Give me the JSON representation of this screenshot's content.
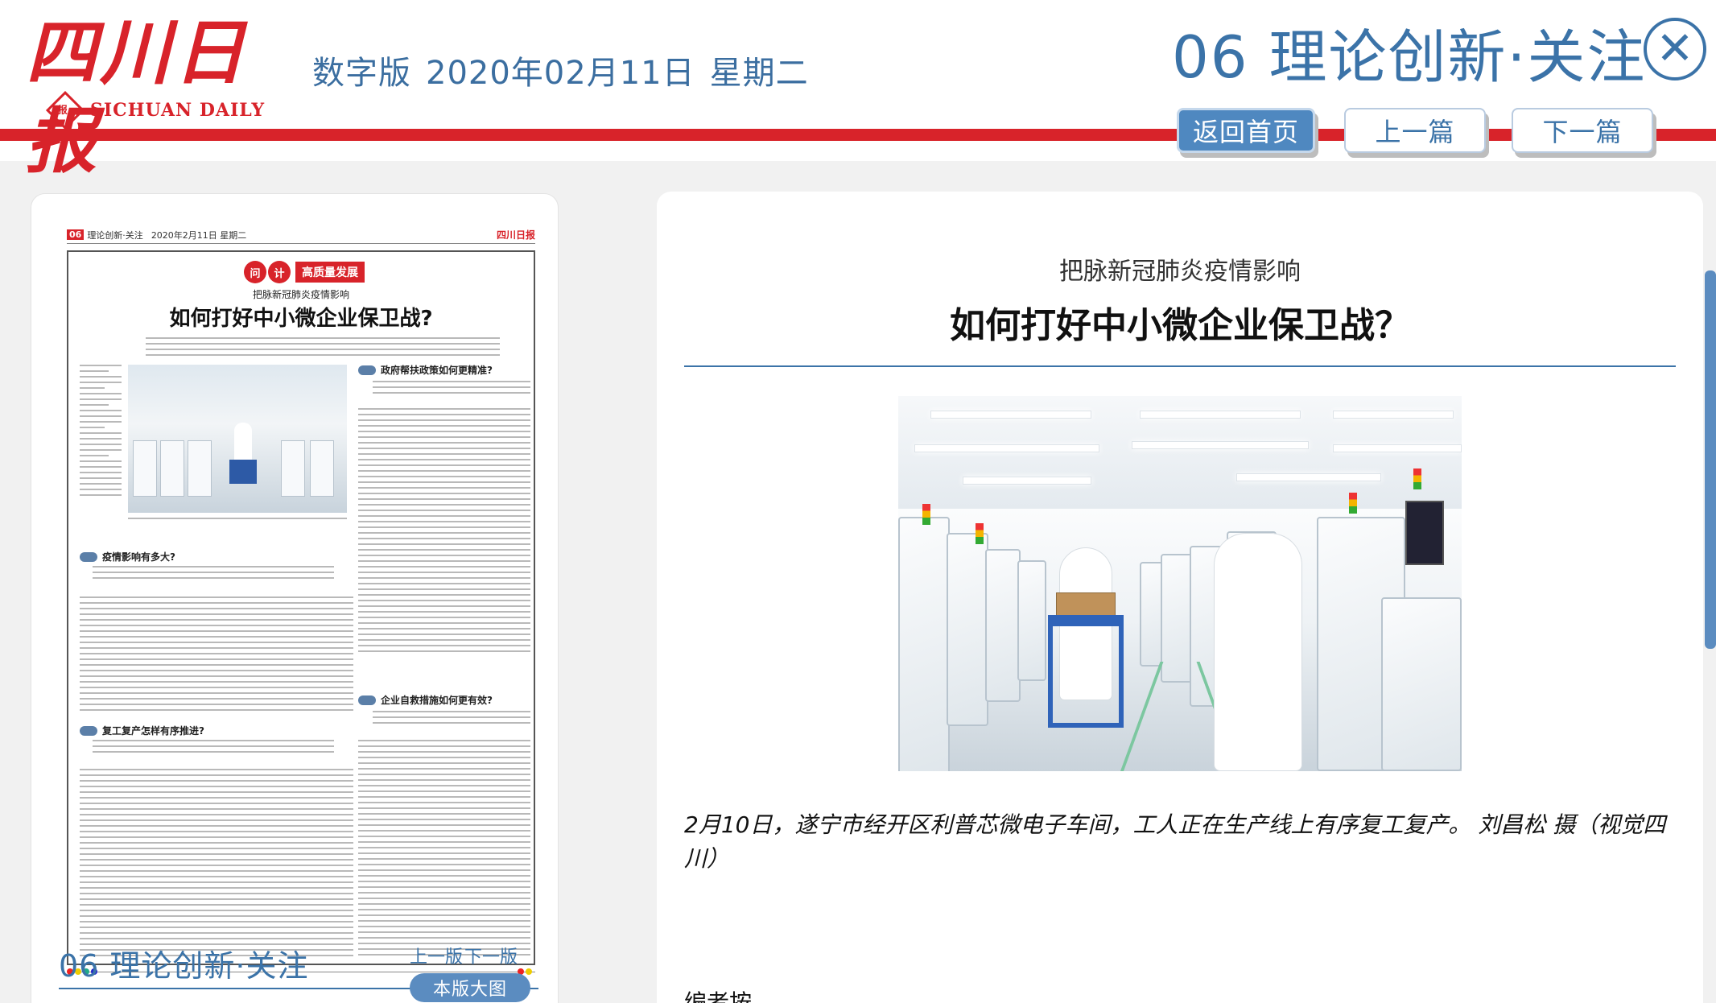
{
  "header": {
    "logo_cn": "四川日报",
    "logo_en": "SICHUAN DAILY",
    "logo_mark": "报",
    "edition_label": "数字版",
    "date": "2020年02月11日",
    "weekday": "星期二",
    "page_heading": "06 理论创新·关注",
    "close_glyph": "✕",
    "nav": {
      "home": "返回首页",
      "prev_article": "上一篇",
      "next_article": "下一篇"
    },
    "accent_red": "#d8232a",
    "accent_blue": "#3b73a8"
  },
  "left_panel": {
    "thumbnail": {
      "page_num": "06",
      "page_name": "理论创新·关注",
      "date": "2020年2月11日 星期二",
      "logo": "四川日报",
      "banner_chars": [
        "问",
        "计"
      ],
      "banner_text": "高质量发展",
      "kicker": "把脉新冠肺炎疫情影响",
      "title": "如何打好中小微企业保卫战?",
      "subheads": [
        "政府帮扶政策如何更精准?",
        "疫情影响有多大?",
        "复工复产怎样有序推进?",
        "企业自救措施如何更有效?"
      ]
    },
    "page_title": "06 理论创新·关注",
    "prev_page": "上一版",
    "next_page": "下一版",
    "full_page_button": "本版大图"
  },
  "article": {
    "kicker": "把脉新冠肺炎疫情影响",
    "headline": "如何打好中小微企业保卫战？",
    "caption": "2月10日，遂宁市经开区利普芯微电子车间，工人正在生产线上有序复工复产。 刘昌松 摄（视觉四川）",
    "next_paragraph": "编者按"
  }
}
